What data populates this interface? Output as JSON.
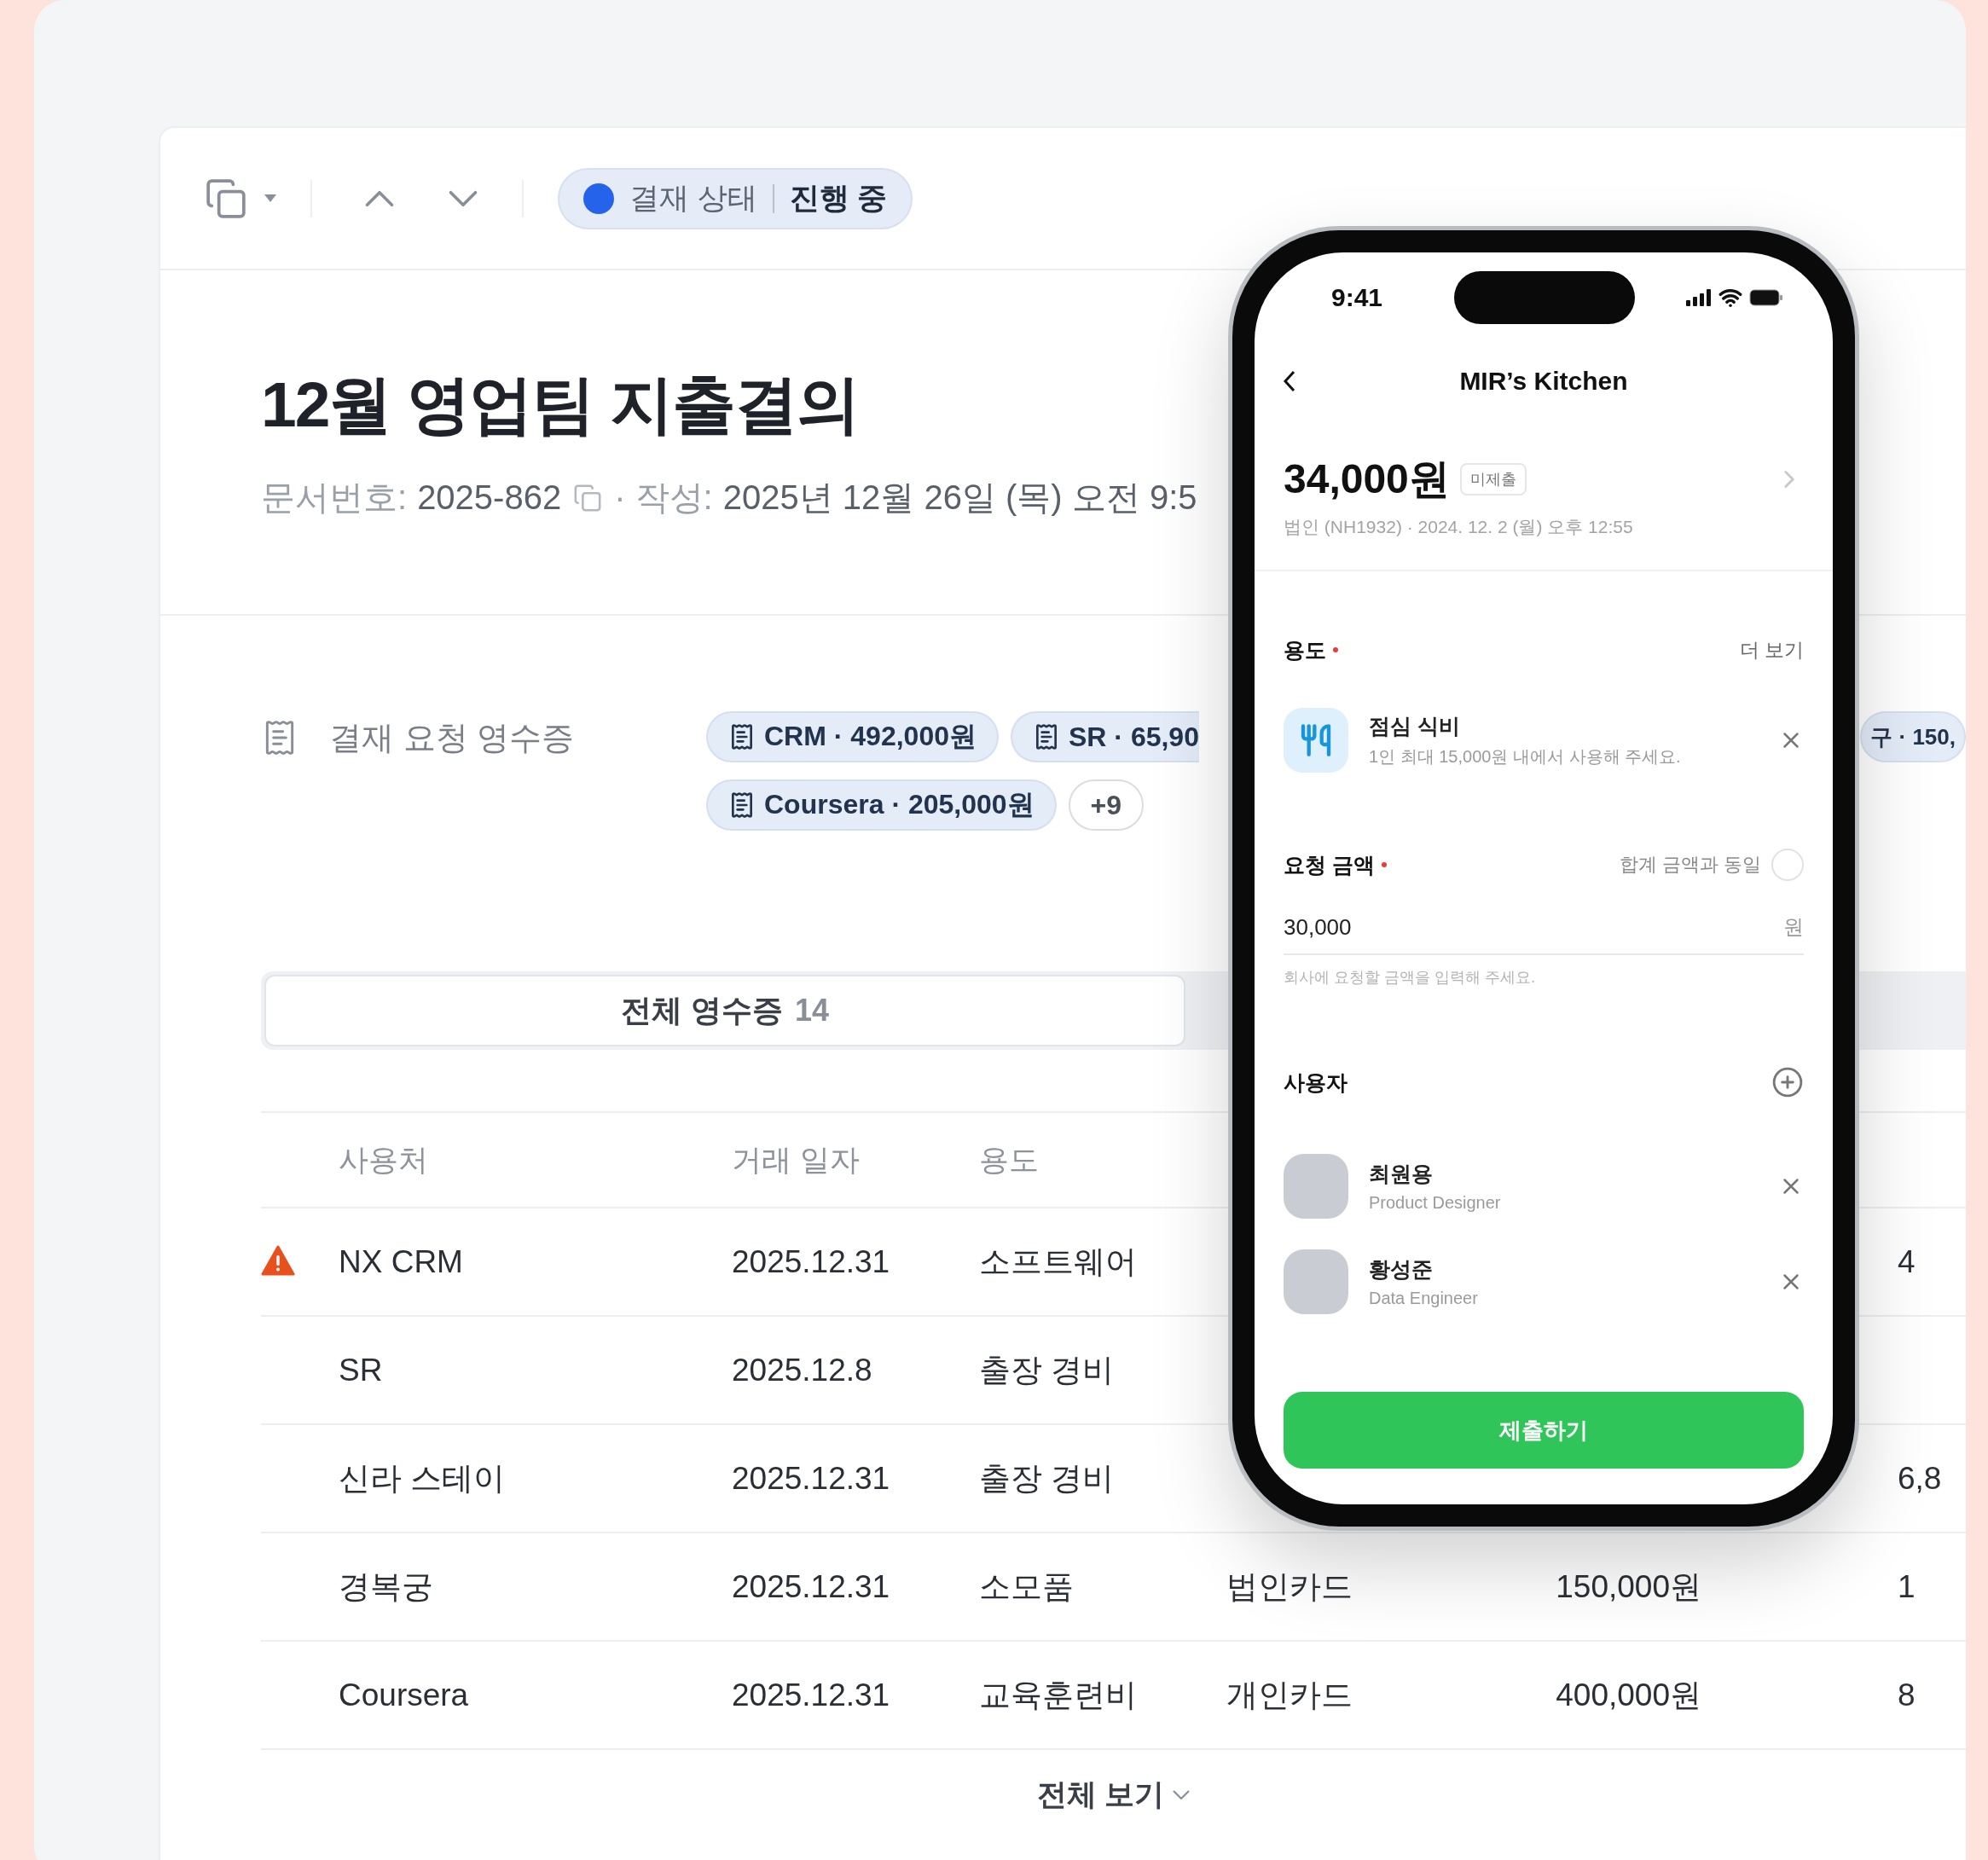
{
  "toolbar": {
    "status": {
      "label": "결재 상태",
      "value": "진행 중",
      "color": "#2563eb"
    }
  },
  "document": {
    "title": "12월 영업팀 지출결의",
    "number_label": "문서번호:",
    "number": "2025-862",
    "written_label": "· 작성:",
    "written": "2025년 12월 26일 (목) 오전 9:5"
  },
  "receipts": {
    "label": "결재 요청 영수증",
    "chip_rows": [
      [
        {
          "text": "CRM · 492,000원",
          "icon": true,
          "kind": "receipt"
        },
        {
          "text": "SR · 65,90",
          "icon": true,
          "kind": "receipt"
        },
        {
          "text": "구 · 150,",
          "icon": false,
          "kind": "receipt"
        }
      ],
      [
        {
          "text": "Coursera · 205,000원",
          "icon": true,
          "kind": "receipt"
        },
        {
          "text": "+9",
          "icon": false,
          "kind": "more"
        }
      ]
    ]
  },
  "tabs": [
    {
      "label": "전체 영수증",
      "count": "14",
      "selected": true
    }
  ],
  "table": {
    "columns": [
      "사용처",
      "거래 일자",
      "용도"
    ],
    "rows": [
      {
        "warning": true,
        "merchant": "NX CRM",
        "date": "2025.12.31",
        "purpose": "소프트웨어",
        "column_6": "4"
      },
      {
        "warning": false,
        "merchant": "SR",
        "date": "2025.12.8",
        "purpose": "출장 경비"
      },
      {
        "warning": false,
        "merchant": "신라 스테이",
        "date": "2025.12.31",
        "purpose": "출장 경비",
        "column_6": "6,8"
      },
      {
        "warning": false,
        "merchant": "경복궁",
        "date": "2025.12.31",
        "purpose": "소모품",
        "column_4": "법인카드",
        "amount": "150,000원",
        "column_6": "1"
      },
      {
        "warning": false,
        "merchant": "Coursera",
        "date": "2025.12.31",
        "purpose": "교육훈련비",
        "column_4": "개인카드",
        "amount": "400,000원",
        "column_6": "8"
      }
    ]
  },
  "show_all": "전체 보기",
  "phone": {
    "time": "9:41",
    "title": "MIR’s Kitchen",
    "amount": "34,000원",
    "badge": "미제출",
    "meta": "법인 (NH1932) · 2024. 12. 2 (월) 오후 12:55",
    "purpose": {
      "label": "용도",
      "required": true,
      "more": "더 보기",
      "item": {
        "title": "점심 식비",
        "description": "1인 최대 15,000원 내에서 사용해 주세요."
      }
    },
    "request": {
      "label": "요청 금액",
      "required": true,
      "same_label": "합계 금액과 동일",
      "same_checked": false,
      "value": "30,000",
      "unit": "원",
      "helper": "회사에 요청할 금액을 입력해 주세요."
    },
    "users": {
      "label": "사용자",
      "items": [
        {
          "name": "최원용",
          "role": "Product Designer"
        },
        {
          "name": "황성준",
          "role": "Data Engineer"
        }
      ]
    },
    "submit": "제출하기"
  }
}
